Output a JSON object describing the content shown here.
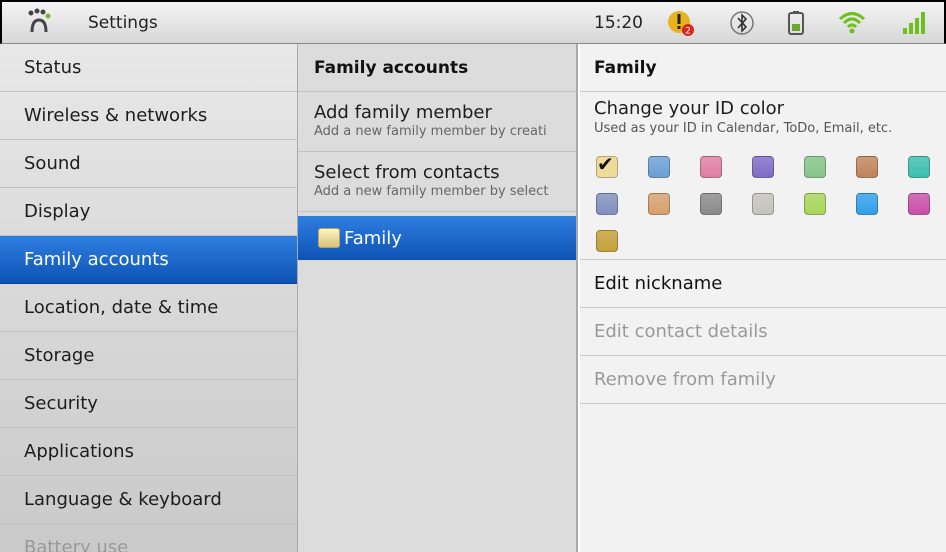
{
  "statusbar": {
    "app_title": "Settings",
    "time": "15:20",
    "notification_count": "2",
    "icons": [
      "app-icon",
      "warning-notification-icon",
      "bluetooth-icon",
      "battery-icon",
      "wifi-icon",
      "signal-icon"
    ]
  },
  "nav": {
    "items": [
      {
        "label": "Status"
      },
      {
        "label": "Wireless & networks"
      },
      {
        "label": "Sound"
      },
      {
        "label": "Display"
      },
      {
        "label": "Family accounts",
        "selected": true
      },
      {
        "label": "Location, date & time"
      },
      {
        "label": "Storage"
      },
      {
        "label": "Security"
      },
      {
        "label": "Applications"
      },
      {
        "label": "Language & keyboard"
      },
      {
        "label": "Battery use"
      }
    ]
  },
  "middle": {
    "header": "Family accounts",
    "add_title": "Add family member",
    "add_subtitle": "Add a new family member by creati",
    "select_title": "Select from contacts",
    "select_subtitle": "Add a new family member by select",
    "selected_family": "Family"
  },
  "right": {
    "header": "Family",
    "color_title": "Change your ID color",
    "color_subtitle": "Used as your ID in Calendar, ToDo, Email, etc.",
    "colors": [
      "#c9a43a",
      "#6b9fd6",
      "#e07da1",
      "#7f6bc6",
      "#86c48a",
      "#c0845a",
      "#3bbfae",
      "#7f8fbf",
      "#d6a06b",
      "#8a8a8a",
      "#c4c4bc",
      "#a7d65a",
      "#2f9fe8",
      "#c94fa8",
      "#c4a039"
    ],
    "selected_color_index": 0,
    "edit_nickname": "Edit nickname",
    "edit_contact": "Edit contact details",
    "remove": "Remove from family"
  }
}
